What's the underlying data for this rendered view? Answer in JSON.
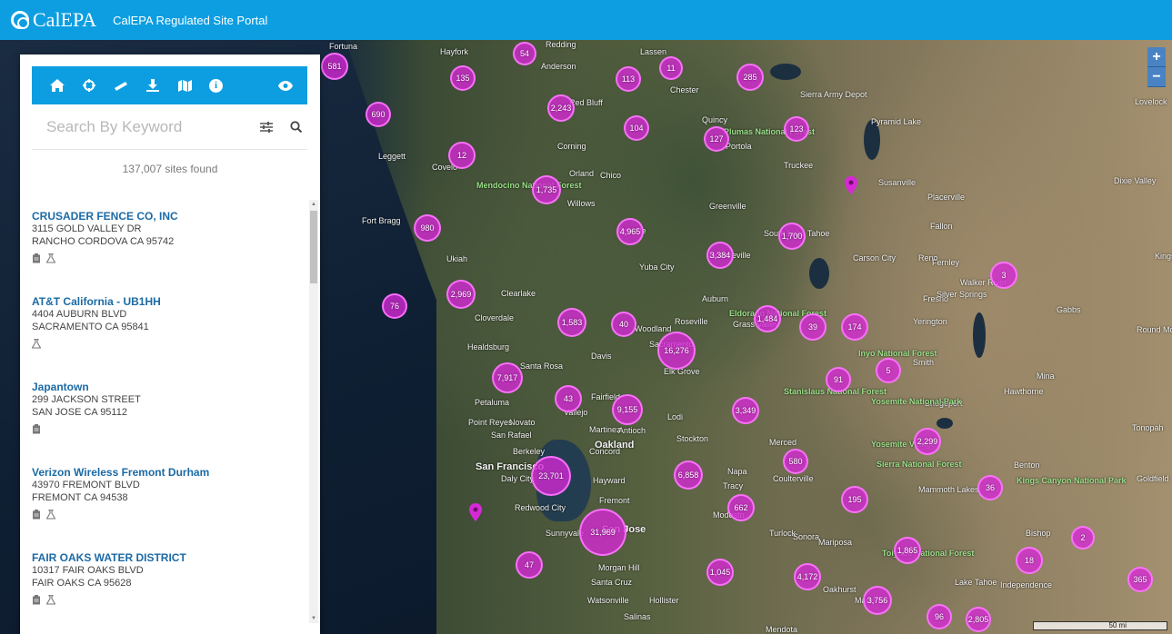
{
  "header": {
    "logo_text": "CalEPA",
    "title": "CalEPA Regulated Site Portal"
  },
  "toolbar": {
    "icons": [
      "home-icon",
      "crosshair-icon",
      "ruler-icon",
      "download-icon",
      "map-icon",
      "info-icon",
      "eye-icon"
    ]
  },
  "search": {
    "placeholder": "Search By Keyword"
  },
  "results": {
    "count_text": "137,007 sites found",
    "items": [
      {
        "name": "CRUSADER FENCE CO, INC",
        "address": "3115 GOLD VALLEY DR",
        "city": "RANCHO CORDOVA CA 95742",
        "icons": [
          "clipboard-icon",
          "flask-icon"
        ]
      },
      {
        "name": "AT&T California - UB1HH",
        "address": "4404 AUBURN BLVD",
        "city": "SACRAMENTO CA 95841",
        "icons": [
          "flask-icon"
        ]
      },
      {
        "name": "Japantown",
        "address": "299 JACKSON STREET",
        "city": "SAN JOSE CA 95112",
        "icons": [
          "clipboard-icon"
        ]
      },
      {
        "name": "Verizon Wireless Fremont Durham",
        "address": "43970 FREMONT BLVD",
        "city": "FREMONT CA 94538",
        "icons": [
          "clipboard-icon",
          "flask-icon"
        ]
      },
      {
        "name": "FAIR OAKS WATER DISTRICT",
        "address": "10317 FAIR OAKS BLVD",
        "city": "FAIR OAKS CA 95628",
        "icons": [
          "clipboard-icon",
          "flask-icon"
        ]
      }
    ]
  },
  "map": {
    "zoom_in": "+",
    "zoom_out": "−",
    "scale": "50 mi",
    "cluster_color": "#d728d7",
    "clusters": [
      "581",
      "54",
      "135",
      "11",
      "113",
      "285",
      "2,243",
      "690",
      "104",
      "127",
      "123",
      "12",
      "1,735",
      "4,965",
      "3,384",
      "1,700",
      "980",
      "2,969",
      "76",
      "1,583",
      "40",
      "16,276",
      "1,484",
      "39",
      "174",
      "7,917",
      "91",
      "5",
      "43",
      "9,155",
      "3,349",
      "2,299",
      "23,701",
      "6,858",
      "580",
      "36",
      "662",
      "195",
      "31,969",
      "2",
      "47",
      "1,045",
      "4,172",
      "1,865",
      "3,756",
      "96",
      "2,805",
      "18",
      "365",
      "3"
    ],
    "labels": [
      "Fortuna",
      "Hayfork",
      "Redding",
      "Anderson",
      "Lassen",
      "Chester",
      "Red Bluff",
      "Corning",
      "Chico",
      "Oroville",
      "Orland",
      "Willows",
      "Leggett",
      "Covelo",
      "Fort Bragg",
      "Ukiah",
      "Clearlake",
      "Cloverdale",
      "Healdsburg",
      "Santa Rosa",
      "Petaluma",
      "Novato",
      "San Rafael",
      "Point Reyes",
      "Berkeley",
      "Oakland",
      "San Francisco",
      "Daly City",
      "Hayward",
      "Fremont",
      "Redwood City",
      "Sunnyvale",
      "San Jose",
      "Morgan Hill",
      "Santa Cruz",
      "Watsonville",
      "Hollister",
      "Salinas",
      "Yuba City",
      "Auburn",
      "Roseville",
      "Woodland",
      "Davis",
      "Sacramento",
      "Elk Grove",
      "Lodi",
      "Stockton",
      "Vallejo",
      "Martinez",
      "Concord",
      "Antioch",
      "Fairfield",
      "Napa",
      "Tracy",
      "Modesto",
      "Turlock",
      "Merced",
      "Sonora",
      "Mariposa",
      "Oakhurst",
      "Madera",
      "Fresno",
      "Reno",
      "Carson City",
      "South Lake Tahoe",
      "Truckee",
      "Portola",
      "Quincy",
      "Greenville",
      "Susanville",
      "Downieville",
      "Grass Valley",
      "Placerville",
      "Fernley",
      "Fallon",
      "Silver Springs",
      "Yerington",
      "Smith",
      "Hawthorne",
      "Mina",
      "Bridgeport",
      "Benton",
      "Bishop",
      "Mammoth Lakes",
      "Tonopah",
      "Lovelock",
      "Dixie Valley",
      "Walker River",
      "Gabbs",
      "Round Mo",
      "Goldfield",
      "Kings",
      "Independence",
      "Mendota",
      "Coulterville",
      "Pyramid Lake",
      "Sierra Army Depot",
      "Plumas National Forest",
      "Mendocino National Forest",
      "Eldorado National Forest",
      "Stanislaus National Forest",
      "Yosemite National Park",
      "Yosemite Village",
      "Sierra National Forest",
      "Toiyabe National Forest",
      "Inyo National Forest",
      "Kings Canyon National Park",
      "Lake Tahoe"
    ]
  }
}
